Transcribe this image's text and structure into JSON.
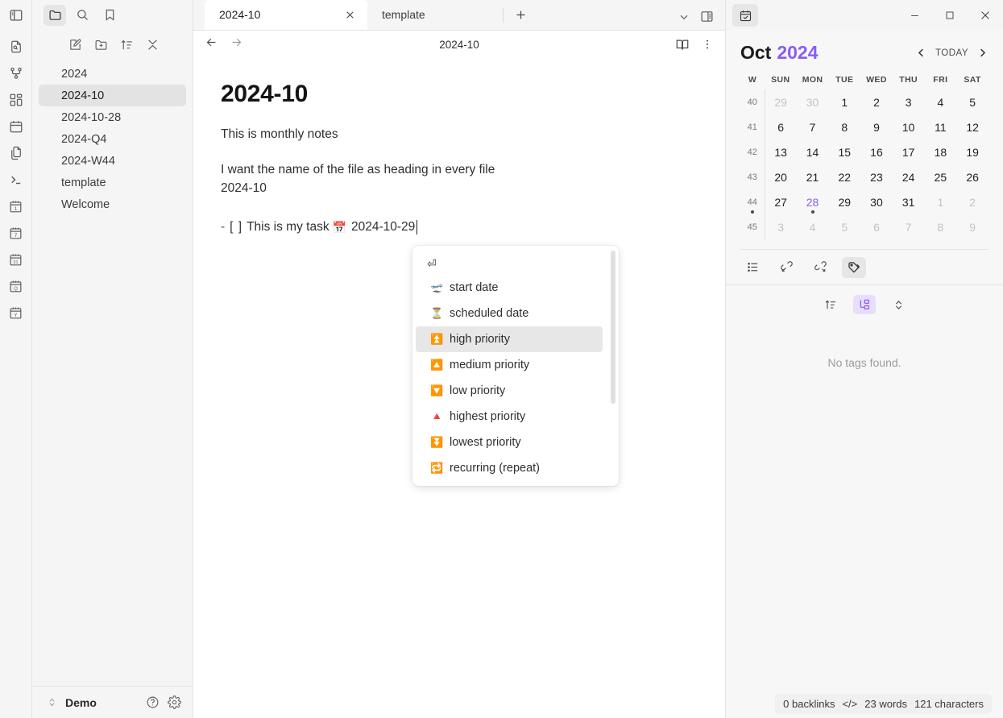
{
  "ribbon": {
    "top_toggle": "sidebar-toggle",
    "items": [
      {
        "name": "quick-switcher-icon",
        "label": "Quick switcher"
      },
      {
        "name": "graph-view-icon",
        "label": "Graph view"
      },
      {
        "name": "canvas-icon",
        "label": "Canvas"
      },
      {
        "name": "calendar-icon",
        "label": "Calendar"
      },
      {
        "name": "copy-files-icon",
        "label": "Templates"
      },
      {
        "name": "terminal-icon",
        "label": "Terminal"
      },
      {
        "name": "daily-note-icon",
        "label": "Daily note",
        "badge": "1"
      },
      {
        "name": "weekly-note-icon",
        "label": "Weekly note",
        "badge": "7"
      },
      {
        "name": "monthly-note-icon",
        "label": "Monthly note",
        "badge": "31"
      },
      {
        "name": "quarterly-note-icon",
        "label": "Quarterly note",
        "badge": "Q"
      },
      {
        "name": "yearly-note-icon",
        "label": "Yearly note",
        "badge": "Y"
      },
      {
        "name": "templater-icon",
        "label": "<%"
      }
    ]
  },
  "explorer": {
    "header_icons": [
      {
        "name": "new-note-icon",
        "label": "New note"
      },
      {
        "name": "new-folder-icon",
        "label": "New folder"
      },
      {
        "name": "sort-order-icon",
        "label": "Change sort order"
      },
      {
        "name": "collapse-all-icon",
        "label": "Collapse all"
      }
    ],
    "files": [
      {
        "label": "2024",
        "selected": false
      },
      {
        "label": "2024-10",
        "selected": true
      },
      {
        "label": "2024-10-28",
        "selected": false
      },
      {
        "label": "2024-Q4",
        "selected": false
      },
      {
        "label": "2024-W44",
        "selected": false
      },
      {
        "label": "template",
        "selected": false
      },
      {
        "label": "Welcome",
        "selected": false
      }
    ],
    "status": {
      "vault": "Demo",
      "help_icon": "help-icon",
      "settings_icon": "settings-gear-icon"
    }
  },
  "tabs": {
    "items": [
      {
        "label": "2024-10",
        "active": true
      },
      {
        "label": "template",
        "active": false
      }
    ],
    "new_tab_label": "+",
    "right_icons": [
      {
        "name": "tab-list-chevron-icon"
      },
      {
        "name": "right-sidebar-toggle-icon"
      }
    ]
  },
  "view_header": {
    "title": "2024-10",
    "back_label": "Back",
    "forward_label": "Forward",
    "reading_view_icon": "book-open-icon",
    "more_options_icon": "more-vertical-icon"
  },
  "document": {
    "heading": "2024-10",
    "paragraph1": "This is monthly notes",
    "paragraph2_line1": "I want the name of the file as heading in every file",
    "paragraph2_line2": "2024-10",
    "task": {
      "dash": "-",
      "checkbox": "[  ]",
      "text": "This is my task",
      "date_emoji": "📅",
      "date": "2024-10-29"
    }
  },
  "suggest_popup": {
    "enter_hint": "⏎",
    "items": [
      {
        "emoji": "🛫",
        "label": "start date",
        "selected": false
      },
      {
        "emoji": "⏳",
        "label": "scheduled date",
        "selected": false
      },
      {
        "emoji": "⏫",
        "label": "high priority",
        "selected": true
      },
      {
        "emoji": "🔼",
        "label": "medium priority",
        "selected": false
      },
      {
        "emoji": "🔽",
        "label": "low priority",
        "selected": false
      },
      {
        "emoji": "🔺",
        "label": "highest priority",
        "selected": false
      },
      {
        "emoji": "⏬",
        "label": "lowest priority",
        "selected": false
      },
      {
        "emoji": "🔁",
        "label": "recurring (repeat)",
        "selected": false
      }
    ]
  },
  "window": {
    "pane_icon": "calendar-check-icon",
    "minimize": "—",
    "maximize": "▢",
    "close": "✕"
  },
  "calendar": {
    "month": "Oct",
    "year": "2024",
    "prev_label": "‹",
    "today_label": "TODAY",
    "next_label": "›",
    "accent_color": "#8a5cf6",
    "headers": [
      "W",
      "SUN",
      "MON",
      "TUE",
      "WED",
      "THU",
      "FRI",
      "SAT"
    ],
    "weeks": [
      {
        "w": "40",
        "w_dot": false,
        "days": [
          {
            "n": "29",
            "adj": true
          },
          {
            "n": "30",
            "adj": true
          },
          {
            "n": "1"
          },
          {
            "n": "2"
          },
          {
            "n": "3"
          },
          {
            "n": "4"
          },
          {
            "n": "5"
          }
        ]
      },
      {
        "w": "41",
        "w_dot": false,
        "days": [
          {
            "n": "6"
          },
          {
            "n": "7"
          },
          {
            "n": "8"
          },
          {
            "n": "9"
          },
          {
            "n": "10"
          },
          {
            "n": "11"
          },
          {
            "n": "12"
          }
        ]
      },
      {
        "w": "42",
        "w_dot": false,
        "days": [
          {
            "n": "13"
          },
          {
            "n": "14"
          },
          {
            "n": "15"
          },
          {
            "n": "16"
          },
          {
            "n": "17"
          },
          {
            "n": "18"
          },
          {
            "n": "19"
          }
        ]
      },
      {
        "w": "43",
        "w_dot": false,
        "days": [
          {
            "n": "20"
          },
          {
            "n": "21"
          },
          {
            "n": "22"
          },
          {
            "n": "23"
          },
          {
            "n": "24"
          },
          {
            "n": "25"
          },
          {
            "n": "26"
          }
        ]
      },
      {
        "w": "44",
        "w_dot": true,
        "days": [
          {
            "n": "27"
          },
          {
            "n": "28",
            "today": true,
            "dot": true
          },
          {
            "n": "29"
          },
          {
            "n": "30"
          },
          {
            "n": "31"
          },
          {
            "n": "1",
            "adj": true
          },
          {
            "n": "2",
            "adj": true
          }
        ]
      },
      {
        "w": "45",
        "w_dot": false,
        "days": [
          {
            "n": "3",
            "adj": true
          },
          {
            "n": "4",
            "adj": true
          },
          {
            "n": "5",
            "adj": true
          },
          {
            "n": "6",
            "adj": true
          },
          {
            "n": "7",
            "adj": true
          },
          {
            "n": "8",
            "adj": true
          },
          {
            "n": "9",
            "adj": true
          }
        ]
      }
    ]
  },
  "right_pane": {
    "tabs": [
      {
        "name": "outline-icon",
        "active": false
      },
      {
        "name": "backlinks-icon",
        "active": false
      },
      {
        "name": "outgoing-links-icon",
        "active": false
      },
      {
        "name": "tags-icon",
        "active": true
      }
    ],
    "tag_toolbar": [
      {
        "name": "sort-tags-icon",
        "active": false
      },
      {
        "name": "nested-tags-icon",
        "active": true
      },
      {
        "name": "expand-collapse-icon",
        "active": false
      }
    ],
    "empty_message": "No tags found."
  },
  "editor_status": {
    "backlinks": "0 backlinks",
    "code_icon": "</>",
    "words": "23 words",
    "characters": "121 characters"
  }
}
